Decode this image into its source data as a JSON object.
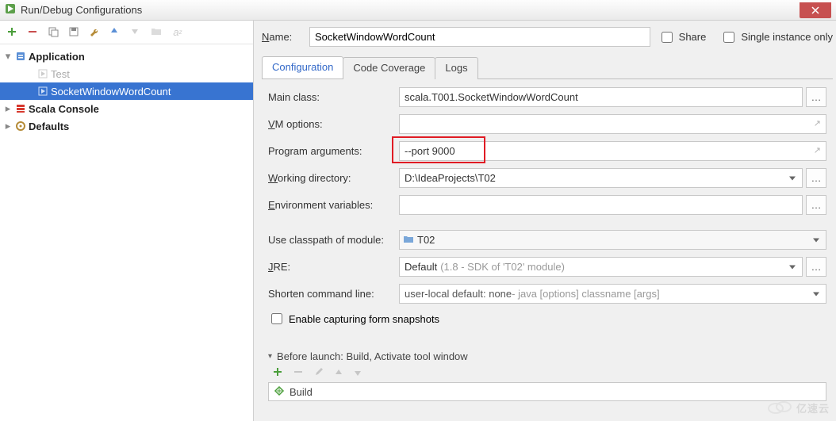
{
  "window": {
    "title": "Run/Debug Configurations"
  },
  "toolbar_icons": [
    "add",
    "remove",
    "copy",
    "save",
    "wrench",
    "up",
    "down",
    "folder",
    "sort"
  ],
  "tree": {
    "app": {
      "label": "Application",
      "children": [
        "Test",
        "SocketWindowWordCount"
      ],
      "selected_index": 1
    },
    "scala_console": "Scala Console",
    "defaults": "Defaults"
  },
  "name": {
    "label": "Name:",
    "value": "SocketWindowWordCount"
  },
  "share": {
    "label": "Share"
  },
  "single_instance": {
    "label": "Single instance only"
  },
  "tabs": [
    "Configuration",
    "Code Coverage",
    "Logs"
  ],
  "form": {
    "main_class": {
      "label": "Main class:",
      "value": "scala.T001.SocketWindowWordCount"
    },
    "vm_options": {
      "label": "VM options:",
      "value": ""
    },
    "program_args": {
      "label": "Program arguments:",
      "value": "--port 9000"
    },
    "working_dir": {
      "label": "Working directory:",
      "value": "D:\\IdeaProjects\\T02"
    },
    "env_vars": {
      "label": "Environment variables:",
      "value": ""
    },
    "classpath_module": {
      "label": "Use classpath of module:",
      "value": "T02"
    },
    "jre": {
      "label": "JRE:",
      "value": "Default",
      "extra": "(1.8 - SDK of 'T02' module)"
    },
    "shorten": {
      "label": "Shorten command line:",
      "pre": "user-local default: none",
      "suffix": " - java [options] classname [args]"
    },
    "snapshots": {
      "label": "Enable capturing form snapshots"
    }
  },
  "before_launch": {
    "title": "Before launch: Build, Activate tool window",
    "item": "Build"
  },
  "watermark": "亿速云"
}
